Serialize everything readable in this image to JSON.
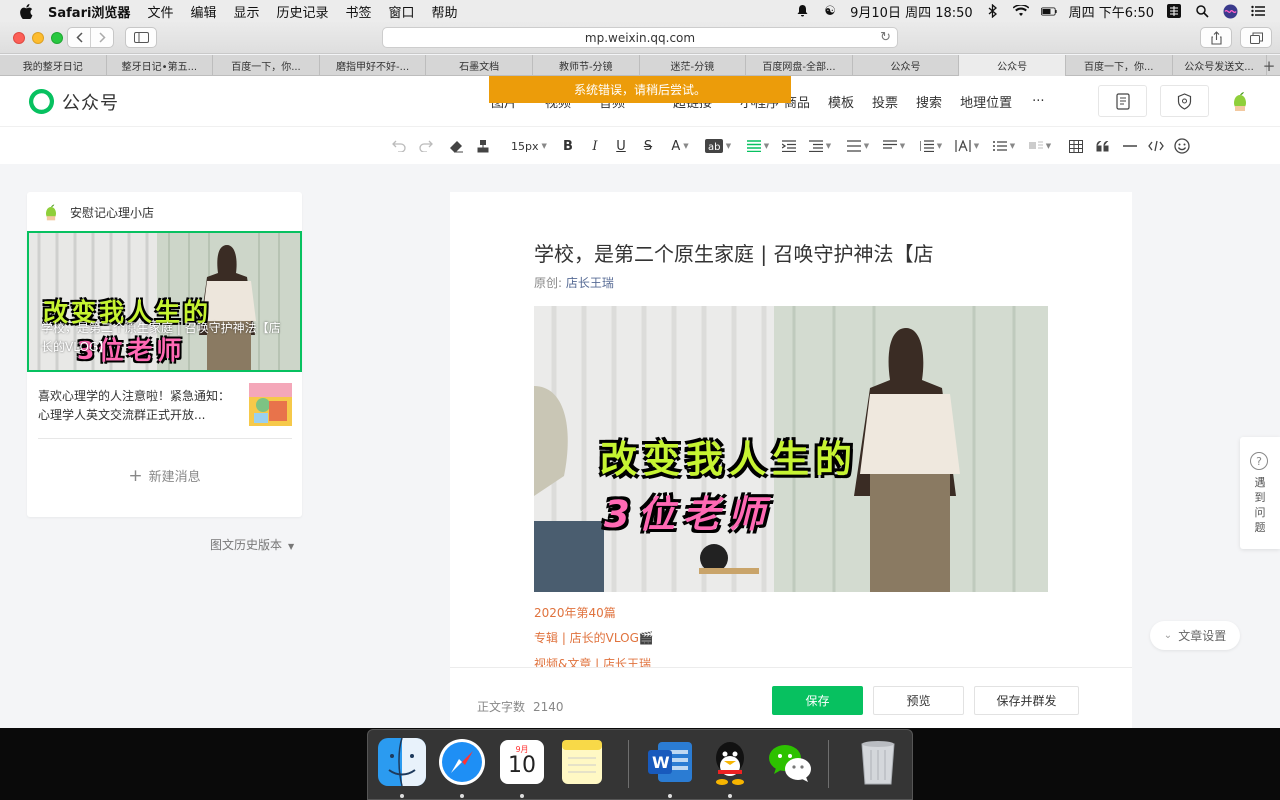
{
  "menubar": {
    "app_name": "Safari浏览器",
    "items": [
      "文件",
      "编辑",
      "显示",
      "历史记录",
      "书签",
      "窗口",
      "帮助"
    ],
    "datetime_short": "9月10日 周四 18:50",
    "clock": "周四 下午6:50"
  },
  "browser": {
    "url": "mp.weixin.qq.com",
    "tabs": [
      "我的整牙日记",
      "整牙日记•第五...",
      "百度一下，你...",
      "磨指甲好不好-...",
      "石墨文档",
      "教师节-分镜",
      "迷茫-分镜",
      "百度网盘-全部...",
      "公众号",
      "公众号",
      "百度一下，你...",
      "公众号发送文..."
    ],
    "active_tab_index": 9
  },
  "header": {
    "logo_text": "公众号",
    "nav_partial": [
      "图片",
      "视频",
      "音频",
      "超链接",
      "小程序"
    ],
    "nav": [
      "商品",
      "模板",
      "投票",
      "搜索",
      "地理位置",
      "···"
    ],
    "error_toast": "系统错误，请稍后尝试。"
  },
  "toolbar": {
    "font_size": "15px"
  },
  "left_panel": {
    "account_name": "安慰记心理小店",
    "cover_caption": "学校，是第二个原生家庭 | 召唤守护神法【店长的VLOG】",
    "cover_overlay_line1": "改变我人生的",
    "cover_overlay_line2": "3位老师",
    "item2_text": "喜欢心理学的人注意啦！紧急通知：心理学人英文交流群正式开放...",
    "new_message": "新建消息",
    "history": "图文历史版本"
  },
  "article": {
    "title": "学校，是第二个原生家庭 | 召唤守护神法【店",
    "author_prefix": "原创:",
    "author": "店长王瑞",
    "image_line1": "改变我人生的",
    "image_line2": "3位老师",
    "meta1": "2020年第40篇",
    "meta2": "专辑 | 店长的VLOG🎬",
    "meta3": "视频&文章 | 店长王瑞"
  },
  "footer": {
    "word_count_label": "正文字数",
    "word_count": "2140",
    "save": "保存",
    "preview": "预览",
    "save_publish": "保存并群发"
  },
  "side": {
    "help": "遇到问题",
    "article_settings": "文章设置"
  },
  "dock": {
    "calendar_month": "9月",
    "calendar_day": "10"
  },
  "colors": {
    "brand_green": "#07c160",
    "error_toast": "#ec9c0a",
    "meta_orange": "#e0733e",
    "author_link": "#576b95"
  }
}
